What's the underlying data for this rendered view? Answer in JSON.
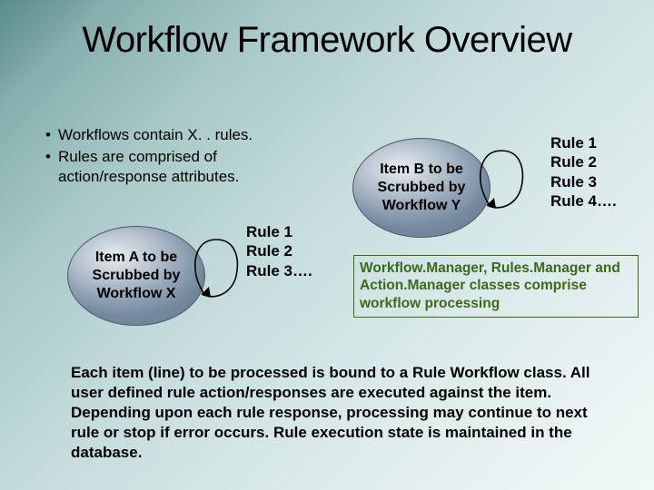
{
  "title": "Workflow Framework Overview",
  "bullets": [
    "Workflows contain X. . rules.",
    "Rules are comprised of action/response attributes."
  ],
  "itemA": {
    "line1": "Item A to be",
    "line2": "Scrubbed by",
    "line3": "Workflow X"
  },
  "itemB": {
    "line1": "Item B to be",
    "line2": "Scrubbed by",
    "line3": "Workflow Y"
  },
  "rulesA": [
    "Rule 1",
    "Rule 2",
    "Rule 3…."
  ],
  "rulesB": [
    "Rule 1",
    "Rule 2",
    "Rule 3",
    "Rule 4…."
  ],
  "mgrBox": "Workflow.Manager, Rules.Manager and Action.Manager classes comprise workflow processing",
  "footer": "Each item (line) to be processed is bound to a Rule Workflow class. All user defined rule action/responses are executed against the item. Depending upon each rule response, processing may continue to next rule or stop if error occurs. Rule execution state is maintained in the database."
}
